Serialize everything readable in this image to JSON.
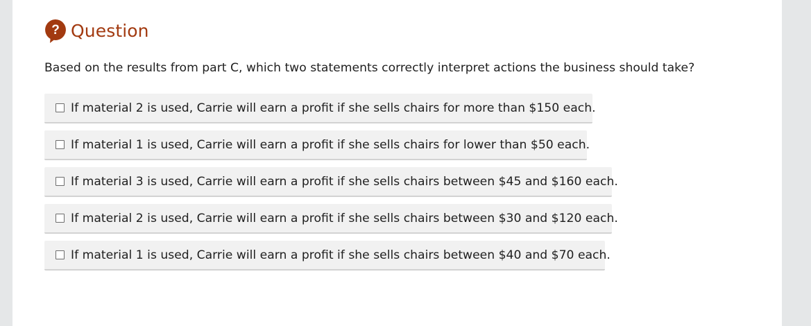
{
  "question": {
    "icon": "question-mark-icon",
    "icon_glyph": "?",
    "accent_color": "#a23a10",
    "header": "Question",
    "prompt": "Based on the results from part C, which two statements correctly interpret actions the business should take?"
  },
  "options": [
    {
      "label": "If material 2 is used, Carrie will earn a profit if she sells chairs for more than $150 each.",
      "checked": false
    },
    {
      "label": "If material 1 is used, Carrie will earn a profit if she sells chairs for lower than $50 each.",
      "checked": false
    },
    {
      "label": "If material 3 is used, Carrie will earn a profit if she sells chairs between $45 and $160 each.",
      "checked": false
    },
    {
      "label": "If material 2 is used, Carrie will earn a profit if she sells chairs between $30 and $120 each.",
      "checked": false
    },
    {
      "label": "If material 1 is used, Carrie will earn a profit if she sells chairs between $40 and $70 each.",
      "checked": false
    }
  ]
}
